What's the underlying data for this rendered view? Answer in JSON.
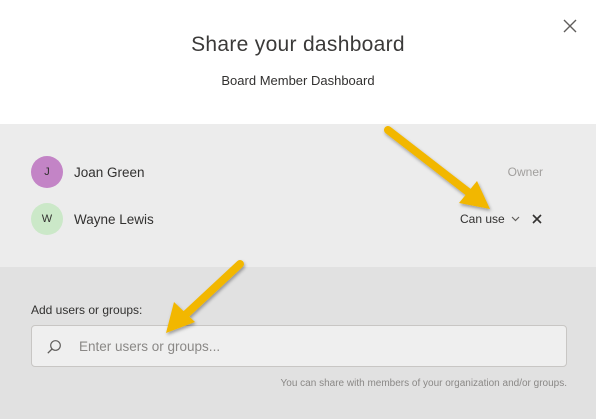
{
  "dialog": {
    "title": "Share your dashboard",
    "subtitle": "Board Member Dashboard",
    "close_icon": "close-icon"
  },
  "members": [
    {
      "initial": "J",
      "name": "Joan Green",
      "role": "Owner",
      "avatar_color": "#c384c6"
    },
    {
      "initial": "W",
      "name": "Wayne Lewis",
      "permission": "Can use",
      "avatar_color": "#cbe8c8",
      "dropdown_icon": "chevron-down-icon",
      "remove_icon": "close-icon"
    }
  ],
  "add_users": {
    "label": "Add users or groups:",
    "placeholder": "Enter users or groups...",
    "search_icon": "search-icon",
    "helper_text": "You can share with members of your organization and/or groups."
  },
  "annotations": {
    "arrow_color": "#f2b705"
  }
}
